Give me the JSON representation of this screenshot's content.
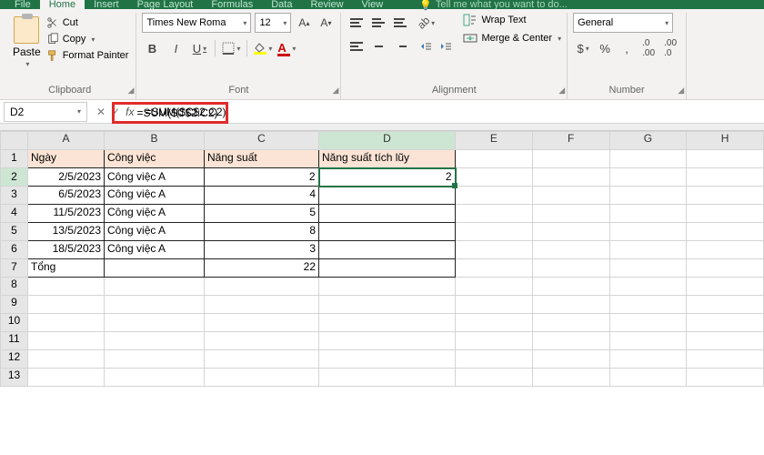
{
  "tabs": {
    "file": "File",
    "home": "Home",
    "insert": "Insert",
    "layout": "Page Layout",
    "formulas": "Formulas",
    "data": "Data",
    "review": "Review",
    "view": "View",
    "tell": "Tell me what you want to do..."
  },
  "ribbon": {
    "paste": "Paste",
    "cut": "Cut",
    "copy": "Copy",
    "formatPainter": "Format Painter",
    "clipboard": "Clipboard",
    "fontName": "Times New Roma",
    "fontSize": "12",
    "font": "Font",
    "wrap": "Wrap Text",
    "merge": "Merge & Center",
    "alignment": "Alignment",
    "general": "General",
    "number": "Number"
  },
  "nameBox": "D2",
  "formula": "=SUM($C$2:C2)",
  "cols": [
    "A",
    "B",
    "C",
    "D",
    "E",
    "F",
    "G",
    "H"
  ],
  "headers": {
    "a": "Ngày",
    "b": "Công việc",
    "c": "Năng suất",
    "d": "Năng suất tích lũy"
  },
  "rows": [
    {
      "n": "2",
      "a": "2/5/2023",
      "b": "Công việc A",
      "c": "2",
      "d": "2"
    },
    {
      "n": "3",
      "a": "6/5/2023",
      "b": "Công việc A",
      "c": "4",
      "d": ""
    },
    {
      "n": "4",
      "a": "11/5/2023",
      "b": "Công việc A",
      "c": "5",
      "d": ""
    },
    {
      "n": "5",
      "a": "13/5/2023",
      "b": "Công việc A",
      "c": "8",
      "d": ""
    },
    {
      "n": "6",
      "a": "18/5/2023",
      "b": "Công việc A",
      "c": "3",
      "d": ""
    }
  ],
  "total": {
    "label": "Tổng",
    "c": "22"
  },
  "emptyRows": [
    "8",
    "9",
    "10",
    "11",
    "12",
    "13"
  ]
}
